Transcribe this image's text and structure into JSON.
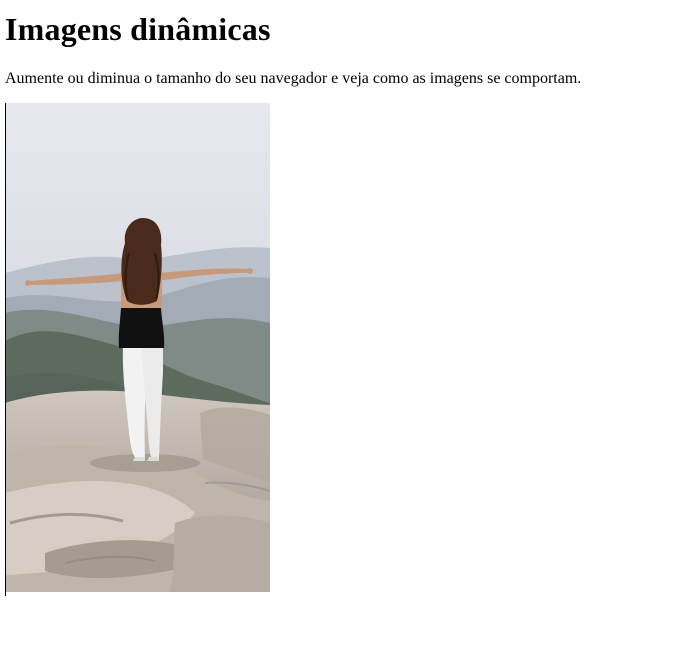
{
  "page": {
    "title": "Imagens dinâmicas",
    "description": "Aumente ou diminua o tamanho do seu navegador e veja como as imagens se comportam."
  },
  "image": {
    "semantic": "photo-woman-mountain-icon",
    "colors": {
      "sky_top": "#e6e8ee",
      "sky_bottom": "#c9ced6",
      "far_hills": "#a9b1bb",
      "mid_hills": "#7f8b86",
      "near_hills": "#5d6b5f",
      "rock_light": "#cfc7bd",
      "rock_dark": "#8c857c",
      "shirt": "#111111",
      "pants": "#f4f4f4",
      "hair": "#4a2a1a",
      "skin": "#c89a7c"
    }
  }
}
